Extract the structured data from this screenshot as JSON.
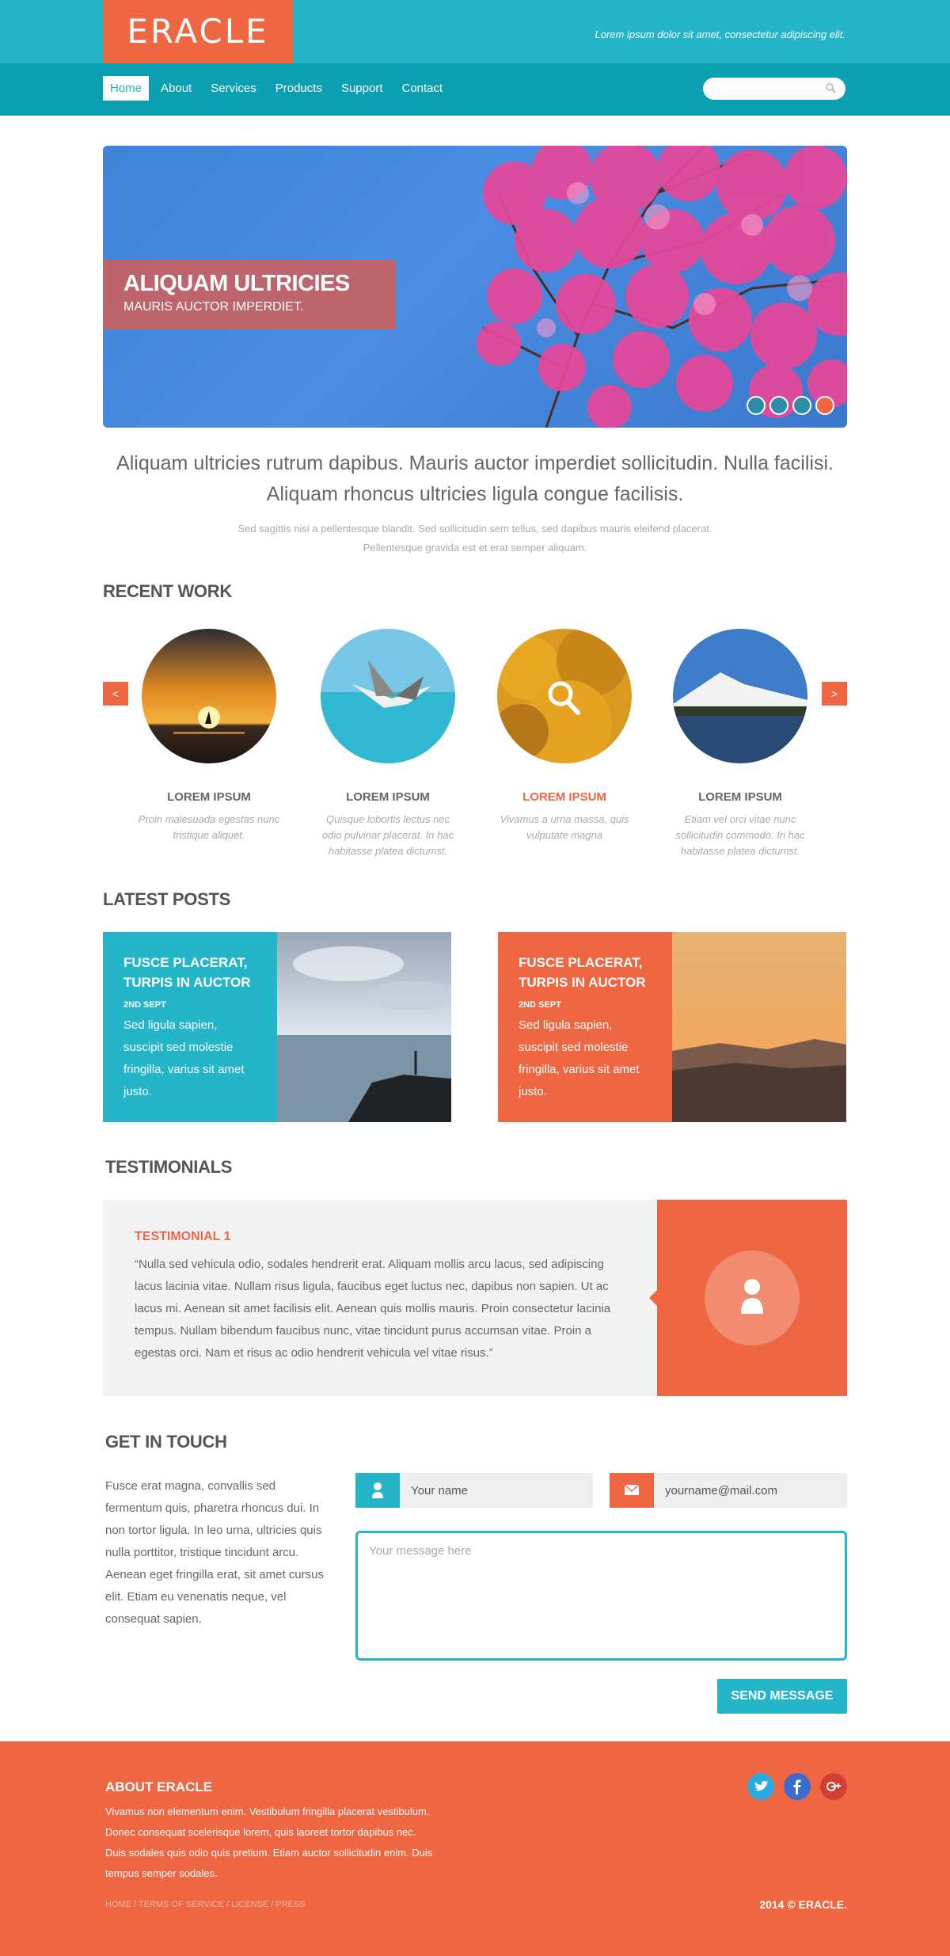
{
  "brand": {
    "logo": "ERACLE",
    "tagline": "Lorem ipsum dolor sit amet, consectetur adipiscing elit."
  },
  "nav": {
    "items": [
      "Home",
      "About",
      "Services",
      "Products",
      "Support",
      "Contact"
    ],
    "active": "Home"
  },
  "search": {
    "placeholder": "",
    "icon": "search-icon"
  },
  "hero": {
    "title": "ALIQUAM ULTRICIES",
    "subtitle": "MAURIS AUCTOR IMPERDIET.",
    "slides": 4,
    "active_slide": 4
  },
  "intro": {
    "lead": "Aliquam ultricies rutrum dapibus. Mauris auctor imperdiet sollicitudin. Nulla facilisi. Aliquam rhoncus ultricies ligula congue facilisis.",
    "sub": "Sed sagittis nisi a pellentesque blandit. Sed sollicitudin sem tellus, sed dapibus mauris eleifend placerat. Pellentesque gravida est et erat semper aliquam."
  },
  "recent_work": {
    "heading": "RECENT WORK",
    "prev_label": "<",
    "next_label": ">",
    "items": [
      {
        "title": "LOREM IPSUM",
        "desc": "Proin malesuada egestas nunc tristique aliquet."
      },
      {
        "title": "LOREM IPSUM",
        "desc": "Quisque lobortis lectus nec odio pulvinar placerat.  In hac habitasse platea dictumst."
      },
      {
        "title": "LOREM IPSUM",
        "desc": "Vivamus a urna massa,  quis vulputate magna"
      },
      {
        "title": "LOREM IPSUM",
        "desc": "Etiam vel orci vitae nunc sollicitudin commodo. In hac habitasse platea dictumst."
      }
    ]
  },
  "latest_posts": {
    "heading": "LATEST POSTS",
    "items": [
      {
        "title": "FUSCE PLACERAT, TURPIS IN AUCTOR",
        "date": "2ND SEPT",
        "body": "Sed ligula sapien, suscipit sed molestie fringilla, varius sit amet justo."
      },
      {
        "title": "FUSCE PLACERAT, TURPIS IN AUCTOR",
        "date": "2ND SEPT",
        "body": "Sed ligula sapien, suscipit sed molestie fringilla, varius sit amet justo."
      }
    ]
  },
  "testimonials": {
    "heading": "TESTIMONIALS",
    "title": "TESTIMONIAL 1",
    "body": "“Nulla sed vehicula odio, sodales hendrerit erat. Aliquam mollis arcu lacus, sed adipiscing lacus lacinia vitae. Nullam risus ligula, faucibus eget luctus nec, dapibus non sapien. Ut ac lacus mi. Aenean sit amet facilisis elit. Aenean quis mollis mauris. Proin consectetur lacinia tempus. Nullam bibendum faucibus nunc, vitae tincidunt purus accumsan vitae. Proin a egestas orci. Nam et risus ac odio hendrerit vehicula vel vitae risus.”"
  },
  "contact": {
    "heading": "GET IN TOUCH",
    "text": "Fusce erat magna, convallis sed fermentum quis, pharetra rhoncus dui. In non tortor ligula. In leo urna, ultricies quis nulla porttitor, tristique tincidunt arcu. Aenean eget fringilla erat, sit amet cursus elit. Etiam eu venenatis neque, vel consequat sapien.",
    "name_placeholder": "Your name",
    "email_placeholder": "yourname@mail.com",
    "message_placeholder": "Your message here",
    "send_label": "SEND MESSAGE"
  },
  "footer": {
    "title": "ABOUT ERACLE",
    "body": "Vivamus non elementum enim. Vestibulum fringilla placerat vestibulum. Donec consequat scelerisque lorem, quis laoreet tortor dapibus nec. Duis sodales quis odio quis pretium. Etiam auctor sollicitudin enim. Duis tempus semper sodales.",
    "links": "HOME / TERMS OF SERVICE / LICENSE / PRESS",
    "copyright": "2014 © ERACLE.",
    "social": [
      "twitter-icon",
      "facebook-icon",
      "google-plus-icon"
    ]
  },
  "colors": {
    "teal": "#24b5c8",
    "teal_dark": "#0ba0b1",
    "orange": "#ee6642"
  }
}
